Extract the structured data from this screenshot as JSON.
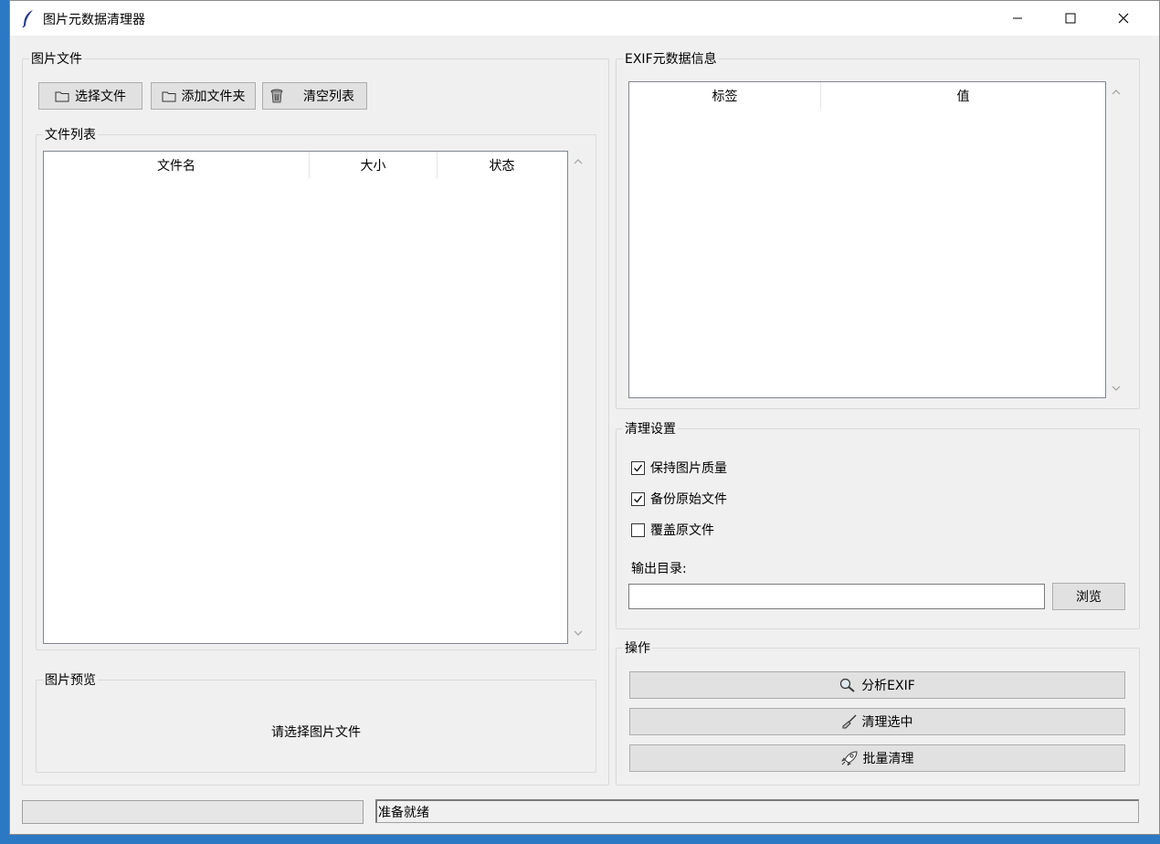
{
  "window": {
    "title": "图片元数据清理器",
    "icon": "feather-icon"
  },
  "files_group": {
    "title": "图片文件",
    "select_files": "选择文件",
    "add_folder": "添加文件夹",
    "clear_list": "清空列表"
  },
  "file_list": {
    "title": "文件列表",
    "columns": [
      "文件名",
      "大小",
      "状态"
    ]
  },
  "preview": {
    "title": "图片预览",
    "placeholder": "请选择图片文件"
  },
  "exif": {
    "title": "EXIF元数据信息",
    "columns": [
      "标签",
      "值"
    ]
  },
  "settings": {
    "title": "清理设置",
    "keep_quality": {
      "label": "保持图片质量",
      "checked": true
    },
    "backup_original": {
      "label": "备份原始文件",
      "checked": true
    },
    "overwrite_original": {
      "label": "覆盖原文件",
      "checked": false
    },
    "output_dir_label": "输出目录:",
    "output_dir_value": "",
    "browse": "浏览"
  },
  "actions": {
    "title": "操作",
    "analyze": "分析EXIF",
    "clean_selected": "清理选中",
    "batch_clean": "批量清理"
  },
  "status": {
    "text": "准备就绪"
  }
}
